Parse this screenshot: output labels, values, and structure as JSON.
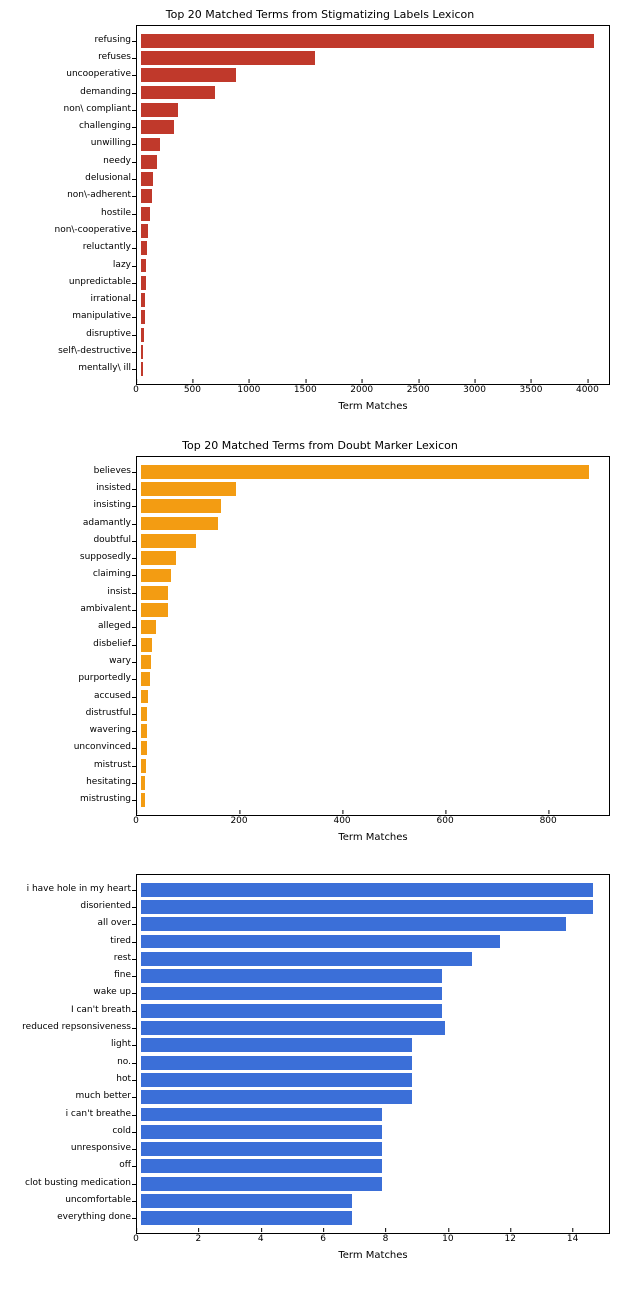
{
  "chart_data": [
    {
      "type": "bar",
      "orientation": "horizontal",
      "title": "Top 20 Matched Terms from Stigmatizing Labels Lexicon",
      "xlabel": "Term Matches",
      "ylabel": "",
      "color": "#c0392b",
      "xlim": [
        0,
        4200
      ],
      "xticks": [
        0,
        500,
        1000,
        1500,
        2000,
        2500,
        3000,
        3500,
        4000
      ],
      "categories": [
        "refusing",
        "refuses",
        "uncooperative",
        "demanding",
        "non\\ compliant",
        "challenging",
        "unwilling",
        "needy",
        "delusional",
        "non\\-adherent",
        "hostile",
        "non\\-cooperative",
        "reluctantly",
        "lazy",
        "unpredictable",
        "irrational",
        "manipulative",
        "disruptive",
        "self\\-destructive",
        "mentally\\ ill"
      ],
      "values": [
        4150,
        1600,
        870,
        680,
        340,
        300,
        170,
        150,
        110,
        100,
        80,
        60,
        55,
        50,
        45,
        40,
        35,
        30,
        18,
        15
      ]
    },
    {
      "type": "bar",
      "orientation": "horizontal",
      "title": "Top 20 Matched Terms from Doubt Marker Lexicon",
      "xlabel": "Term Matches",
      "ylabel": "",
      "color": "#f39c12",
      "xlim": [
        0,
        920
      ],
      "xticks": [
        0,
        200,
        400,
        600,
        800
      ],
      "categories": [
        "believes",
        "insisted",
        "insisting",
        "adamantly",
        "doubtful",
        "supposedly",
        "claiming",
        "insist",
        "ambivalent",
        "alleged",
        "disbelief",
        "wary",
        "purportedly",
        "accused",
        "distrustful",
        "wavering",
        "unconvinced",
        "mistrust",
        "hesitating",
        "mistrusting"
      ],
      "values": [
        900,
        190,
        160,
        155,
        110,
        70,
        60,
        55,
        55,
        30,
        22,
        20,
        18,
        15,
        12,
        12,
        12,
        10,
        8,
        8
      ]
    },
    {
      "type": "bar",
      "orientation": "horizontal",
      "title": "",
      "xlabel": "Term Matches",
      "ylabel": "",
      "color": "#3b6fd8",
      "xlim": [
        0,
        15.2
      ],
      "xticks": [
        0,
        2,
        4,
        6,
        8,
        10,
        12,
        14
      ],
      "categories": [
        "i have hole in my heart",
        "disoriented",
        "all over",
        "tired",
        "rest",
        "fine",
        "wake up",
        "I can't breath",
        "reduced repsonsiveness",
        "light",
        "no.",
        "hot",
        "much better",
        "i can't breathe",
        "cold",
        "unresponsive",
        "off",
        "clot busting medication",
        "uncomfortable",
        "everything done"
      ],
      "values": [
        15,
        15,
        14.1,
        11.9,
        11,
        10,
        10,
        10,
        10.1,
        9,
        9,
        9,
        9,
        8,
        8,
        8,
        8,
        8,
        7,
        7
      ]
    }
  ]
}
